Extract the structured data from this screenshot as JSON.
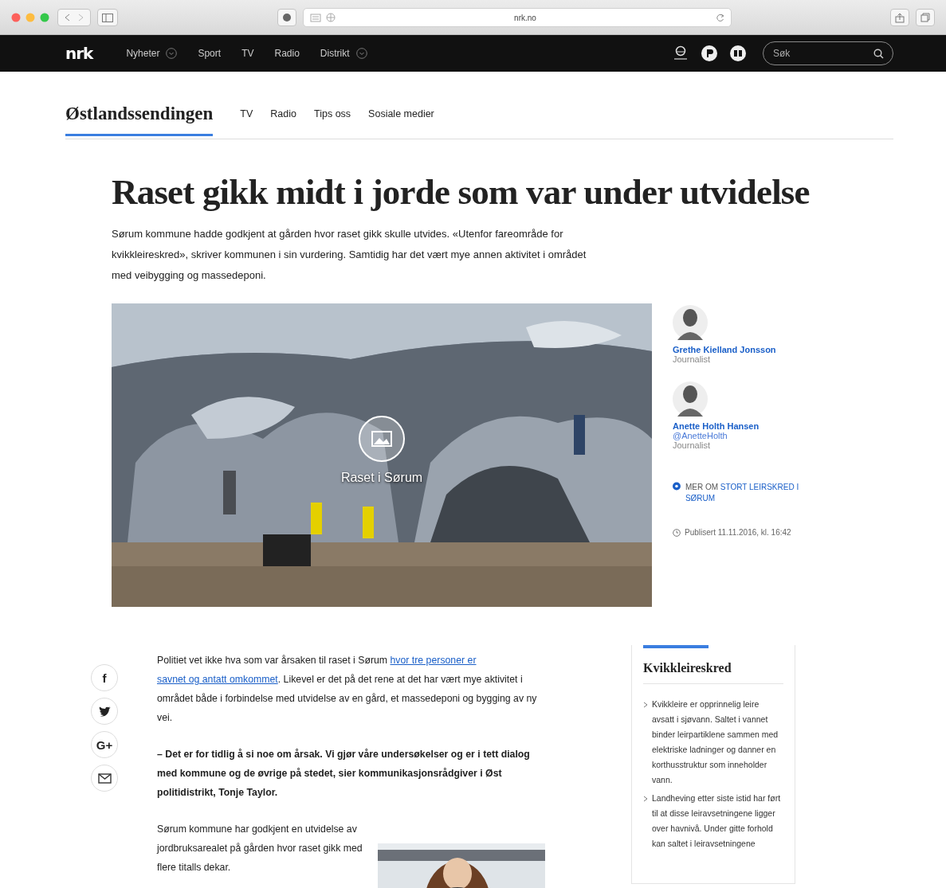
{
  "browser": {
    "url": "nrk.no"
  },
  "nav": {
    "logo": "nrk",
    "items": [
      {
        "label": "Nyheter",
        "dropdown": true
      },
      {
        "label": "Sport",
        "dropdown": false
      },
      {
        "label": "TV",
        "dropdown": false
      },
      {
        "label": "Radio",
        "dropdown": false
      },
      {
        "label": "Distrikt",
        "dropdown": true
      }
    ],
    "search": {
      "placeholder": "Søk"
    }
  },
  "section": {
    "title": "Østlandssendingen",
    "links": [
      "TV",
      "Radio",
      "Tips oss",
      "Sosiale medier"
    ]
  },
  "article": {
    "headline": "Raset gikk midt i jorde som var under utvidelse",
    "lead": "Sørum kommune hadde godkjent at gården hvor raset gikk skulle utvides. «Utenfor fareområde for kvikkleireskred», skriver kommunen i sin vurdering. Samtidig har det vært mye annen aktivitet i området med veibygging og massedeponi.",
    "image": {
      "kind": "picture",
      "caption": "Raset i Sørum"
    },
    "authors": [
      {
        "name": "Grethe Kielland Jonsson",
        "role": "Journalist"
      },
      {
        "name": "Anette Holth Hansen",
        "handle": "@AnetteHolth",
        "role": "Journalist"
      }
    ],
    "related": {
      "prefix": "MER OM",
      "label": "STORT LEIRSKRED I SØRUM"
    },
    "published": "Publisert 11.11.2016, kl. 16:42",
    "share": [
      {
        "kind": "facebook",
        "label": "f"
      },
      {
        "kind": "twitter"
      },
      {
        "kind": "google",
        "label": "G+"
      },
      {
        "kind": "email"
      }
    ],
    "body": [
      {
        "kind": "text",
        "parts": [
          {
            "text": "Politiet vet ikke hva som var årsaken til raset i Sørum "
          },
          {
            "link": "hvor tre personer er"
          },
          {
            "link": "savnet og antatt omkommet"
          },
          {
            "text": ". Likevel er det på det rene at det har vært mye aktivitet i området både i forbindelse med utvidelse av en gård, et massedeponi og bygging av ny vei."
          }
        ]
      },
      {
        "kind": "quote",
        "parts": [
          {
            "text": "– Det er for tidlig å si noe om årsak. Vi gjør våre undersøkelser og er i tett dialog med kommune og de øvrige på stedet, sier kommunikasjonsrådgiver i Øst politidistrikt, Tonje Taylor."
          }
        ]
      },
      {
        "kind": "figure-text",
        "parts": [
          {
            "text": "Sørum kommune har godkjent en utvidelse av jordbruksarealet på gården hvor raset gikk med flere titalls dekar."
          }
        ]
      }
    ],
    "factbox": {
      "title": "Kvikkleireskred",
      "items": [
        "Kvikkleire er opprinnelig leire avsatt i sjøvann. Saltet i vannet binder leirpartiklene sammen med elektriske ladninger og danner en korthusstruktur som inneholder vann.",
        "Landheving etter siste istid har ført til at disse leiravsetningene ligger over havnivå. Under gitte forhold kan saltet i leiravsetningene"
      ]
    }
  }
}
